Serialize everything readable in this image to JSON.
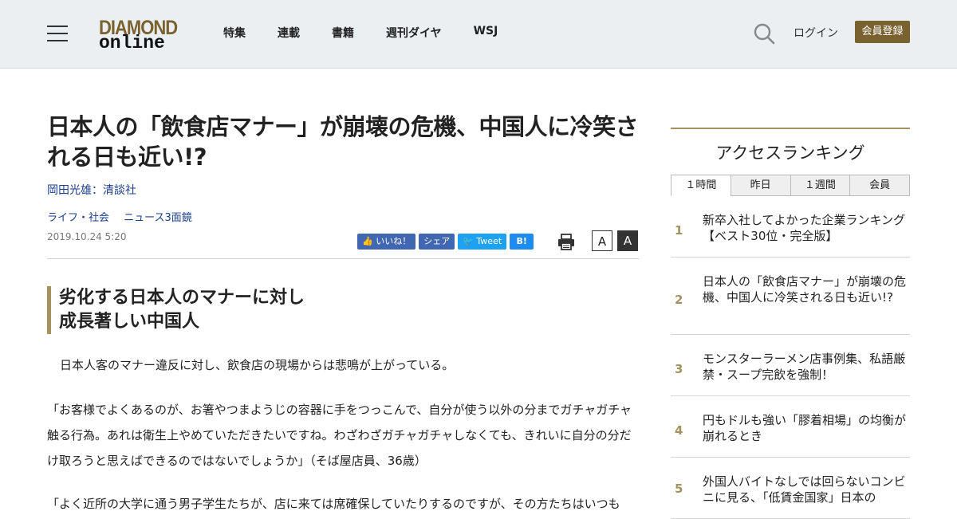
{
  "header": {
    "logo_top": "DIAMOND",
    "logo_bottom": "online",
    "nav": [
      "特集",
      "連載",
      "書籍",
      "週刊ダイヤ",
      "WSJ"
    ],
    "login": "ログイン",
    "register": "会員登録"
  },
  "article": {
    "title": "日本人の「飲食店マナー」が崩壊の危機、中国人に冷笑される日も近い!?",
    "author": "岡田光雄：清談社",
    "tags": [
      "ライフ・社会",
      "ニュース3面鏡"
    ],
    "date": "2019.10.24 5:20",
    "share": {
      "like": "いいね！",
      "share": "シェア",
      "tweet": "Tweet",
      "hatena": "B!"
    },
    "font_small": "A",
    "font_large": "A",
    "subhead_line1": "劣化する日本人のマナーに対し",
    "subhead_line2": "成長著しい中国人",
    "paragraphs": [
      "日本人客のマナー違反に対し、飲食店の現場からは悲鳴が上がっている。",
      "「お客様でよくあるのが、お箸やつまようじの容器に手をつっこんで、自分が使う以外の分までガチャガチャ触る行為。あれは衛生上やめていただきたいですね。わざわざガチャガチャしなくても、きれいに自分の分だけ取ろうと思えばできるのではないでしょうか」（そば屋店員、36歳）",
      "「よく近所の大学に通う男子学生たちが、店に来ては席確保していたりするのですが、その方たちはいつも"
    ]
  },
  "ranking": {
    "title": "アクセスランキング",
    "tabs": [
      "１時間",
      "昨日",
      "１週間",
      "会員"
    ],
    "active_tab": 0,
    "items": [
      {
        "rank": "1",
        "title": "新卒入社してよかった企業ランキング【ベスト30位・完全版】"
      },
      {
        "rank": "2",
        "title": "日本人の「飲食店マナー」が崩壊の危機、中国人に冷笑される日も近い!?"
      },
      {
        "rank": "3",
        "title": "モンスターラーメン店事例集、私語厳禁・スープ完飲を強制！"
      },
      {
        "rank": "4",
        "title": "円もドルも強い「膠着相場」の均衡が崩れるとき"
      },
      {
        "rank": "5",
        "title": "外国人バイトなしでは回らないコンビニに見る、「低賃金国家」日本の"
      }
    ]
  },
  "colors": {
    "brand_gold": "#7a6230",
    "accent_gold": "#a4925e",
    "link_blue": "#1a3e8c",
    "header_bg": "#eceff2"
  }
}
